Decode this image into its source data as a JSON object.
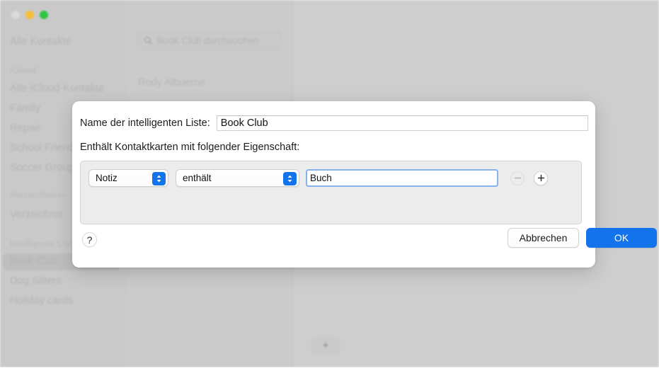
{
  "window": {
    "traffic_lights": {
      "close": "close-button",
      "minimize": "minimize-button",
      "maximize": "maximize-button"
    }
  },
  "sidebar": {
    "all_contacts": "Alle Kontakte",
    "sections": [
      {
        "header": "iCloud",
        "items": [
          "Alle iCloud-Kontakte",
          "Family",
          "Repair",
          "School Friends",
          "Soccer Group"
        ]
      },
      {
        "header": "Verzeichnisse",
        "items": [
          "Verzeichnis"
        ]
      },
      {
        "header": "Intelligente Listen",
        "items": [
          "Book Club",
          "Dog Sitters",
          "Holiday cards"
        ]
      }
    ],
    "selected_item": "Book Club"
  },
  "list_column": {
    "search_placeholder": "Book Club durchsuchen",
    "search_icon": "search-icon",
    "contacts": [
      "Rody Albuerne"
    ]
  },
  "detail_column": {
    "add_button_glyph": "+"
  },
  "dialog": {
    "name_label": "Name der intelligenten Liste:",
    "name_value": "Book Club",
    "name_placeholder": "",
    "criteria_label": "Enthält Kontaktkarten mit folgender Eigenschaft:",
    "rule": {
      "field_value": "Notiz",
      "field_options": [
        "Notiz"
      ],
      "operator_value": "enthält",
      "operator_options": [
        "enthält"
      ],
      "text_value": "Buch",
      "text_placeholder": "",
      "remove_label": "−",
      "add_label": "+"
    },
    "help_label": "?",
    "cancel_label": "Abbrechen",
    "ok_label": "OK"
  },
  "colors": {
    "accent": "#1273ec",
    "sheet_background": "#ffffff",
    "panel_background": "#ececec",
    "window_chrome": "#c8c8c8",
    "focus_ring": "#86b2f0",
    "minimize": "#f8bd35",
    "maximize": "#29c43f"
  }
}
